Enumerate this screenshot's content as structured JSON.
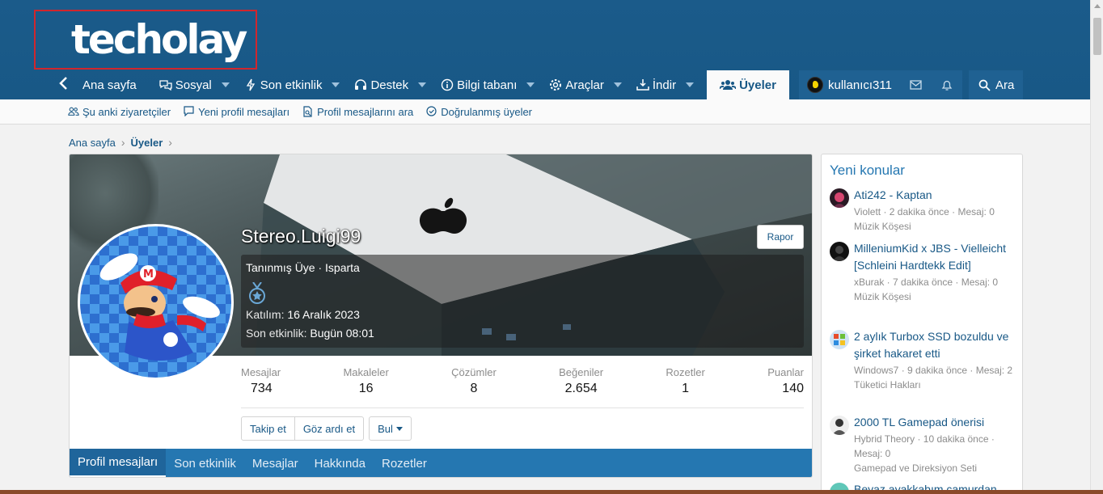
{
  "logo": {
    "text": "techolay"
  },
  "nav": {
    "items": [
      {
        "label": "Ana sayfa"
      },
      {
        "label": "Sosyal"
      },
      {
        "label": "Son etkinlik"
      },
      {
        "label": "Destek"
      },
      {
        "label": "Bilgi tabanı"
      },
      {
        "label": "Araçlar"
      },
      {
        "label": "İndir"
      },
      {
        "label": "Üyeler"
      }
    ],
    "username": "kullanıcı311",
    "search_label": "Ara"
  },
  "subnav": {
    "items": [
      {
        "label": "Şu anki ziyaretçiler"
      },
      {
        "label": "Yeni profil mesajları"
      },
      {
        "label": "Profil mesajlarını ara"
      },
      {
        "label": "Doğrulanmış üyeler"
      }
    ]
  },
  "breadcrumb": {
    "home": "Ana sayfa",
    "current": "Üyeler"
  },
  "profile": {
    "name": "Stereo.Luigi99",
    "report_label": "Rapor",
    "title_line": "Tanınmış Üye · Isparta",
    "joined_label": "Katılım:",
    "joined_value": "16 Aralık 2023",
    "last_activity_label": "Son etkinlik:",
    "last_activity_value": "Bugün 08:01",
    "stats": [
      {
        "label": "Mesajlar",
        "value": "734"
      },
      {
        "label": "Makaleler",
        "value": "16"
      },
      {
        "label": "Çözümler",
        "value": "8"
      },
      {
        "label": "Beğeniler",
        "value": "2.654"
      },
      {
        "label": "Rozetler",
        "value": "1"
      },
      {
        "label": "Puanlar",
        "value": "140"
      }
    ],
    "buttons": {
      "follow": "Takip et",
      "ignore": "Göz ardı et",
      "find": "Bul"
    },
    "tabs": [
      {
        "label": "Profil mesajları"
      },
      {
        "label": "Son etkinlik"
      },
      {
        "label": "Mesajlar"
      },
      {
        "label": "Hakkında"
      },
      {
        "label": "Rozetler"
      }
    ]
  },
  "sidebar": {
    "title": "Yeni konular",
    "threads": [
      {
        "title": "Ati242 - Kaptan",
        "meta": "Violett · 2 dakika önce · Mesaj: 0",
        "forum": "Müzik Köşesi"
      },
      {
        "title": "MilleniumKid x JBS - Vielleicht [Schleini Hardtekk Edit]",
        "meta": "xBurak · 7 dakika önce · Mesaj: 0",
        "forum": "Müzik Köşesi"
      },
      {
        "title": "2 aylık Turbox SSD bozuldu ve şirket hakaret etti",
        "meta": "Windows7 · 9 dakika önce · Mesaj: 2",
        "forum": "Tüketici Hakları"
      },
      {
        "title": "2000 TL Gamepad önerisi",
        "meta": "Hybrid Theory · 10 dakika önce · Mesaj: 0",
        "forum": "Gamepad ve Direksiyon Seti"
      },
      {
        "title": "Beyaz ayakkabım çamurdan"
      }
    ]
  },
  "colors": {
    "header": "#185886",
    "accent": "#2577b1",
    "logo_box": "#d1262d"
  }
}
